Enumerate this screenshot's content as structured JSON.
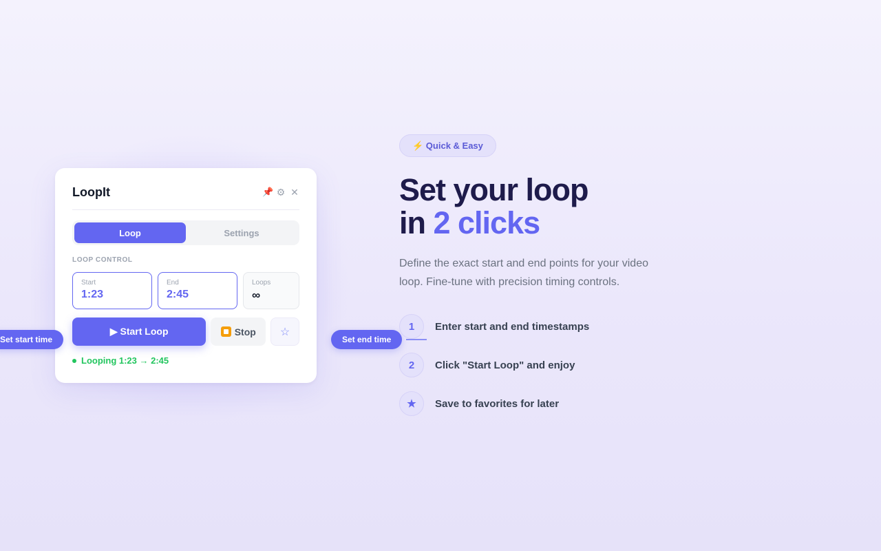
{
  "popup": {
    "title": "LoopIt",
    "header_icons": {
      "pin": "📌",
      "settings": "⚙",
      "close": "✕"
    },
    "tabs": [
      {
        "label": "Loop",
        "active": true
      },
      {
        "label": "Settings",
        "active": false
      }
    ],
    "section_label": "LOOP CONTROL",
    "fields": {
      "start": {
        "label": "Start",
        "value": "1:23"
      },
      "end": {
        "label": "End",
        "value": "2:45"
      },
      "loops": {
        "label": "Loops",
        "value": "∞"
      }
    },
    "buttons": {
      "start_loop": "▶ Start Loop",
      "stop": "Stop",
      "favorite": "☆"
    },
    "status": "Looping 1:23 → 2:45"
  },
  "callouts": {
    "start": "Set start time",
    "end": "Set end time"
  },
  "hero": {
    "badge": "⚡ Quick & Easy",
    "headline_line1": "Set your loop",
    "headline_line2_prefix": "in ",
    "headline_line2_accent": "2 clicks",
    "description": "Define the exact start and end points for your video loop. Fine-tune with precision timing controls.",
    "steps": [
      {
        "marker": "1",
        "text": "Enter start and end timestamps"
      },
      {
        "marker": "2",
        "text": "Click \"Start Loop\" and enjoy"
      },
      {
        "marker": "★",
        "text": "Save to favorites for later"
      }
    ]
  },
  "colors": {
    "accent": "#6366f1",
    "status_green": "#22c55e",
    "headline": "#1e1b4b",
    "stop_orange": "#f59e0b"
  }
}
